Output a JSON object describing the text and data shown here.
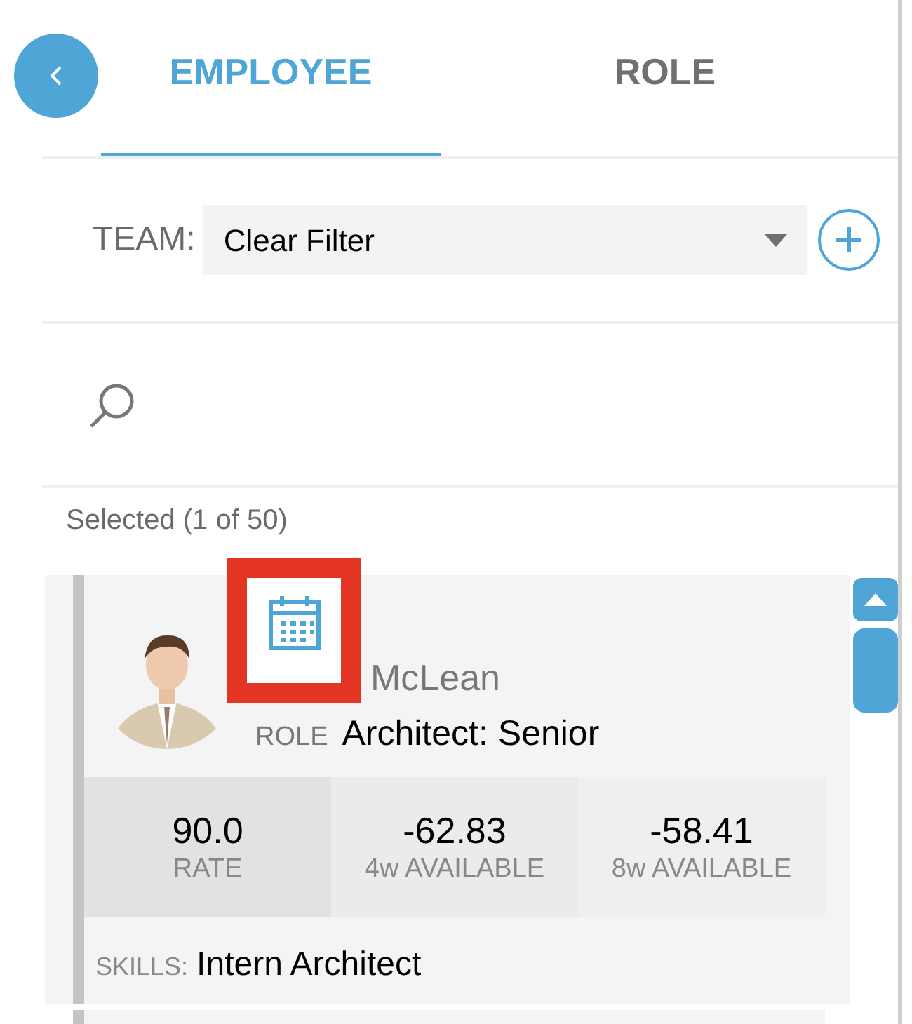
{
  "tabs": [
    {
      "label": "EMPLOYEE",
      "selected": true
    },
    {
      "label": "ROLE",
      "selected": false
    }
  ],
  "team_filter": {
    "label": "TEAM:",
    "value": "Clear Filter"
  },
  "selection_count": "Selected (1 of 50)",
  "employees": [
    {
      "name": "McLean",
      "role_label": "ROLE",
      "role": "Architect: Senior",
      "highlighted": true,
      "skills_label": "SKILLS:",
      "skills": "Intern Architect",
      "stats": [
        {
          "value": "90.0",
          "label": "RATE"
        },
        {
          "value": "-62.83",
          "label": "4w AVAILABLE"
        },
        {
          "value": "-58.41",
          "label": "8w AVAILABLE"
        }
      ]
    }
  ]
}
